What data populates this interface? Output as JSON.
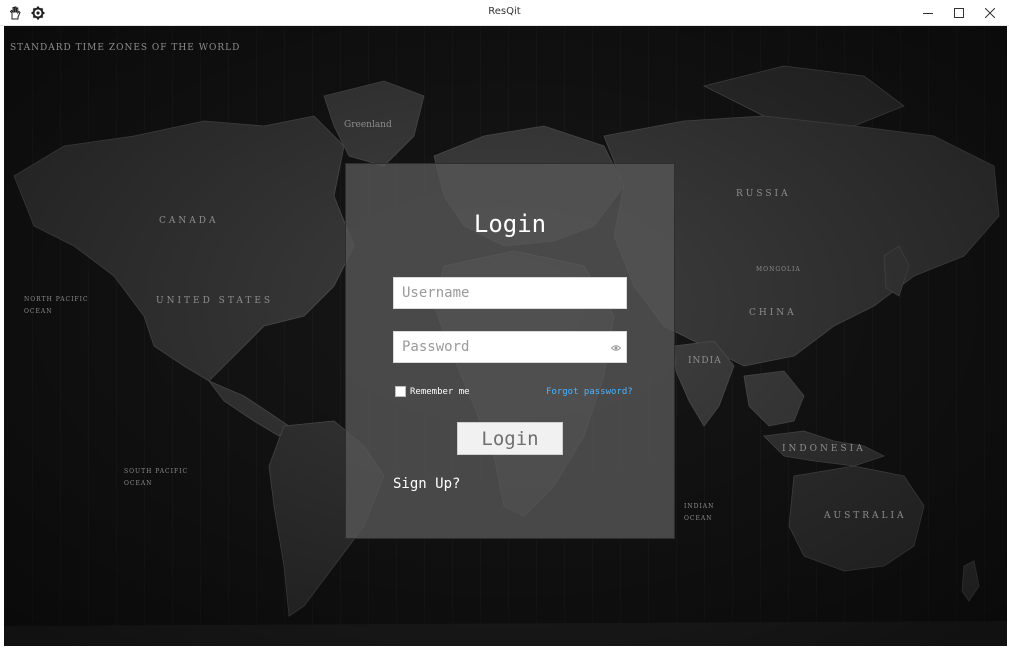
{
  "window": {
    "title": "ResQit",
    "left_icons": [
      "pan-tool-icon",
      "settings-gear-icon"
    ],
    "controls": [
      "minimize-icon",
      "maximize-icon",
      "close-icon"
    ]
  },
  "map": {
    "header": "STANDARD TIME ZONES OF THE WORLD",
    "labels": {
      "canada": "CANADA",
      "united_states": "UNITED STATES",
      "russia": "RUSSIA",
      "china": "CHINA",
      "india": "INDIA",
      "australia": "AUSTRALIA",
      "indonesia": "INDONESIA",
      "mongolia": "MONGOLIA",
      "north_pacific": "NORTH PACIFIC OCEAN",
      "south_pacific": "SOUTH PACIFIC OCEAN",
      "indian_ocean": "INDIAN OCEAN",
      "greenland": "Greenland"
    }
  },
  "login": {
    "title": "Login",
    "username_placeholder": "Username",
    "password_placeholder": "Password",
    "remember_label": "Remember me",
    "forgot_label": "Forgot password?",
    "button_label": "Login",
    "signup_label": "Sign Up?"
  },
  "colors": {
    "link": "#4cb3ff",
    "panel": "#565656",
    "background": "#151515"
  }
}
